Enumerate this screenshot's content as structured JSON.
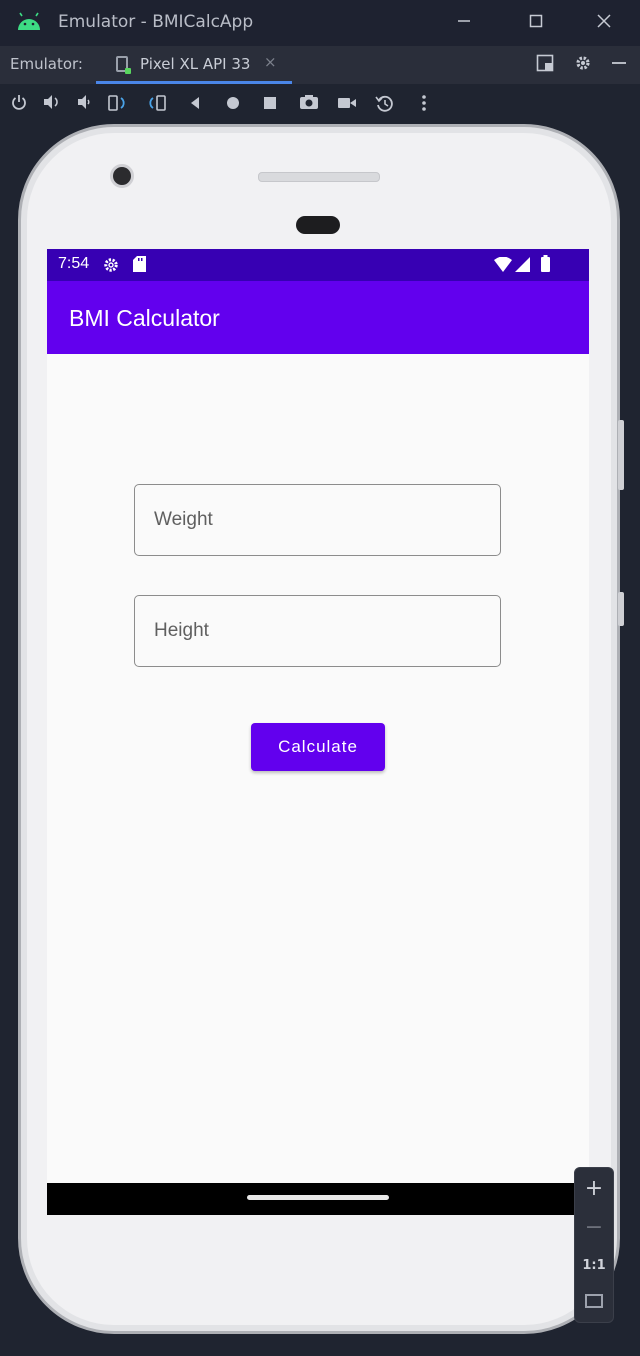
{
  "window": {
    "title": "Emulator - BMICalcApp",
    "minimize_icon": "minimize-icon",
    "maximize_icon": "maximize-icon",
    "close_icon": "close-icon"
  },
  "tabbar": {
    "emulator_label": "Emulator:",
    "tab_label": "Pixel XL API 33",
    "tab_close": "×",
    "accent": "#4a86e8"
  },
  "toolbar": {
    "tools": [
      "power-icon",
      "volume-up-icon",
      "volume-down-icon",
      "rotate-left-icon",
      "rotate-right-icon",
      "back-icon",
      "home-icon",
      "overview-icon",
      "camera-icon",
      "screen-record-icon",
      "snapshot-icon",
      "more-icon"
    ]
  },
  "device": {
    "status_bar": {
      "time": "7:54",
      "color": "#3700b3"
    },
    "app_bar": {
      "title": "BMI Calculator",
      "color": "#6200ee"
    },
    "form": {
      "weight_placeholder": "Weight",
      "weight_value": "",
      "height_placeholder": "Height",
      "height_value": "",
      "calculate_label": "Calculate"
    }
  },
  "zoom": {
    "zoom_in": "+",
    "zoom_out": "−",
    "one_to_one": "1:1"
  }
}
